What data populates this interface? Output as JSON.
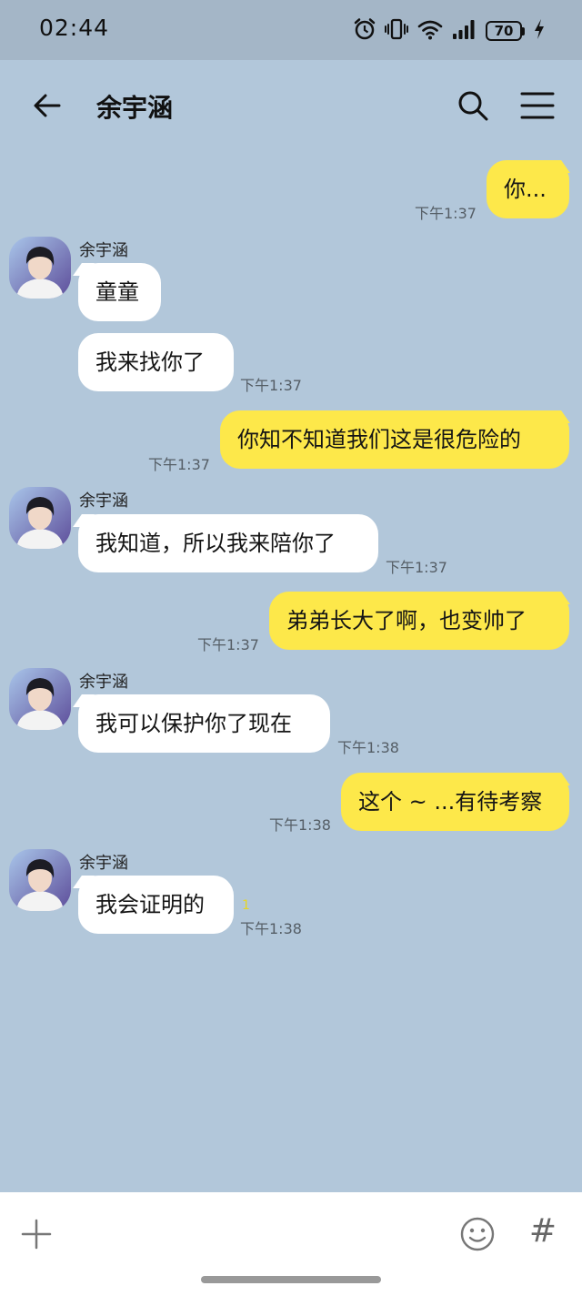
{
  "status_bar": {
    "time": "02:44",
    "battery": "70",
    "icons": [
      "alarm-icon",
      "vibrate-icon",
      "wifi-icon",
      "signal-icon",
      "battery-icon",
      "charging-icon"
    ]
  },
  "header": {
    "title": "余宇涵",
    "back_icon": "back-arrow-icon",
    "search_icon": "search-icon",
    "menu_icon": "menu-icon"
  },
  "messages": [
    {
      "from": "me",
      "text": "你...",
      "time": "下午1:37"
    },
    {
      "from": "them",
      "sender": "余宇涵",
      "text": "童童"
    },
    {
      "from": "them",
      "text": "我来找你了",
      "time": "下午1:37"
    },
    {
      "from": "me",
      "text": "你知不知道我们这是很危险的",
      "time": "下午1:37"
    },
    {
      "from": "them",
      "sender": "余宇涵",
      "text": "我知道，所以我来陪你了",
      "time": "下午1:37"
    },
    {
      "from": "me",
      "text": "弟弟长大了啊，也变帅了",
      "time": "下午1:37"
    },
    {
      "from": "them",
      "sender": "余宇涵",
      "text": "我可以保护你了现在",
      "time": "下午1:38"
    },
    {
      "from": "me",
      "text": "这个 ~ ...有待考察",
      "time": "下午1:38"
    },
    {
      "from": "them",
      "sender": "余宇涵",
      "text": "我会证明的",
      "unread": "1",
      "time": "下午1:38"
    }
  ],
  "input_bar": {
    "plus_icon": "plus-icon",
    "emoji_icon": "emoji-icon",
    "hash_label": "#"
  },
  "colors": {
    "background": "#b2c7da",
    "my_bubble": "#fde84a",
    "their_bubble": "#ffffff",
    "unread": "#e8d620"
  }
}
